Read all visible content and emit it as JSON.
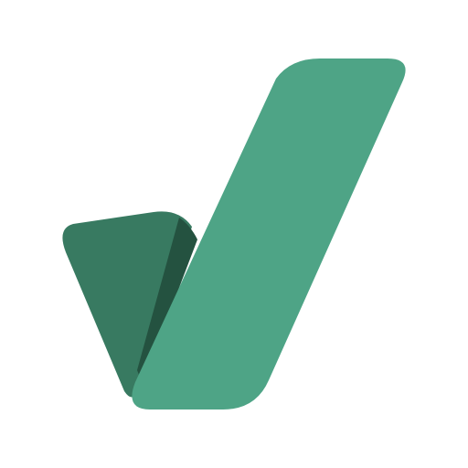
{
  "logo": {
    "icon": "checkmark-icon",
    "colors": {
      "background": "#ffffff",
      "left_stroke": "#387A61",
      "fold_shadow": "#245240",
      "right_stroke": "#4EA486"
    }
  }
}
